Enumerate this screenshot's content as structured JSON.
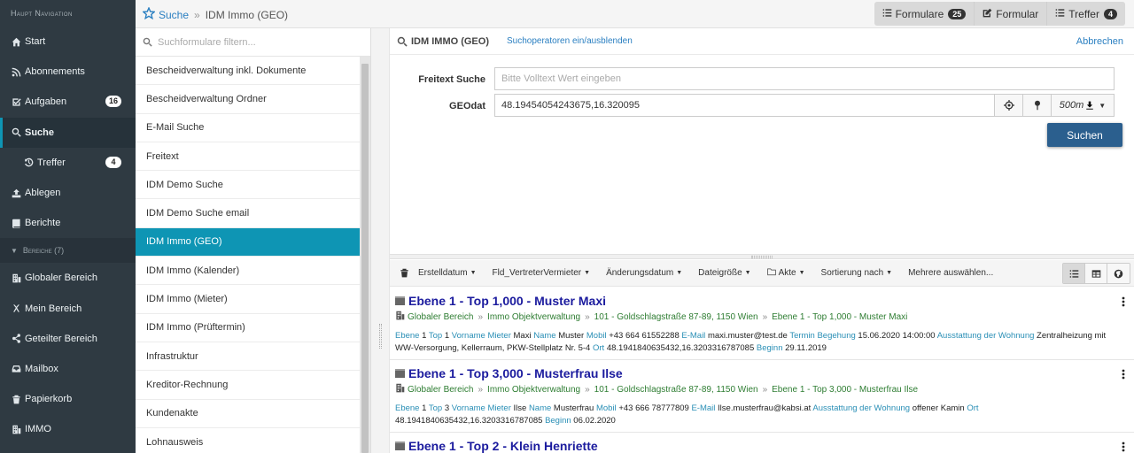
{
  "sidebar": {
    "heading": "Haupt Navigation",
    "items": [
      {
        "label": "Start",
        "icon": "home-icon"
      },
      {
        "label": "Abonnements",
        "icon": "rss-icon"
      },
      {
        "label": "Aufgaben",
        "icon": "check-square-icon",
        "badge": "16"
      },
      {
        "label": "Suche",
        "icon": "search-icon"
      },
      {
        "label": "Treffer",
        "icon": "history-icon",
        "badge": "4"
      },
      {
        "label": "Ablegen",
        "icon": "upload-icon"
      },
      {
        "label": "Berichte",
        "icon": "book-icon"
      }
    ],
    "group_label": "Bereiche (7)",
    "areas": [
      {
        "label": "Globaler Bereich",
        "icon": "building-icon"
      },
      {
        "label": "Mein Bereich",
        "icon": "user-icon"
      },
      {
        "label": "Geteilter Bereich",
        "icon": "share-icon"
      },
      {
        "label": "Mailbox",
        "icon": "inbox-icon"
      },
      {
        "label": "Papierkorb",
        "icon": "trash-icon"
      },
      {
        "label": "IMMO",
        "icon": "building-icon"
      }
    ]
  },
  "topbar": {
    "breadcrumb_root": "Suche",
    "breadcrumb_current": "IDM Immo (GEO)",
    "btn_formulare": "Formulare",
    "btn_formulare_count": "25",
    "btn_formular": "Formular",
    "btn_treffer": "Treffer",
    "btn_treffer_count": "4"
  },
  "forms": {
    "filter_placeholder": "Suchformulare filtern...",
    "items": [
      "Bescheidverwaltung inkl. Dokumente",
      "Bescheidverwaltung Ordner",
      "E-Mail Suche",
      "Freitext",
      "IDM Demo Suche",
      "IDM Demo Suche email",
      "IDM Immo (GEO)",
      "IDM Immo (Kalender)",
      "IDM Immo (Mieter)",
      "IDM Immo (Prüftermin)",
      "Infrastruktur",
      "Kreditor-Rechnung",
      "Kundenakte",
      "Lohnausweis"
    ]
  },
  "search": {
    "title": "IDM IMMO (GEO)",
    "toggle_operators": "Suchoperatoren ein/ausblenden",
    "cancel": "Abbrechen",
    "freitext_label": "Freitext Suche",
    "freitext_placeholder": "Bitte Volltext Wert eingeben",
    "geo_label": "GEOdat",
    "geo_value": "48.19454054243675,16.320095",
    "radius": "500m",
    "submit": "Suchen"
  },
  "toolbar": {
    "sort_fields": [
      "Erstelldatum",
      "Fld_VertreterVermieter",
      "Änderungsdatum",
      "Dateigröße",
      "Akte",
      "Sortierung nach"
    ],
    "more": "Mehrere auswählen..."
  },
  "results": [
    {
      "title": "Ebene 1 - Top 1,000 - Muster Maxi",
      "path": [
        "Globaler Bereich",
        "Immo Objektverwaltung",
        "101 - Goldschlagstraße 87-89, 1150 Wien",
        "Ebene 1 - Top 1,000 - Muster Maxi"
      ],
      "meta": [
        {
          "k": "Ebene",
          "v": "1"
        },
        {
          "k": "Top",
          "v": "1"
        },
        {
          "k": "Vorname Mieter",
          "v": "Maxi"
        },
        {
          "k": "Name",
          "v": "Muster"
        },
        {
          "k": "Mobil",
          "v": "+43 664 61552288"
        },
        {
          "k": "E-Mail",
          "v": "maxi.muster@test.de"
        },
        {
          "k": "Termin Begehung",
          "v": "15.06.2020 14:00:00"
        },
        {
          "k": "Ausstattung der Wohnung",
          "v": "Zentralheizung mit WW-Versorgung, Kellerraum, PKW-Stellplatz Nr. 5-4"
        },
        {
          "k": "Ort",
          "v": "48.1941840635432,16.3203316787085"
        },
        {
          "k": "Beginn",
          "v": "29.11.2019"
        }
      ]
    },
    {
      "title": "Ebene 1 - Top 3,000 - Musterfrau Ilse",
      "path": [
        "Globaler Bereich",
        "Immo Objektverwaltung",
        "101 - Goldschlagstraße 87-89, 1150 Wien",
        "Ebene 1 - Top 3,000 - Musterfrau Ilse"
      ],
      "meta": [
        {
          "k": "Ebene",
          "v": "1"
        },
        {
          "k": "Top",
          "v": "3"
        },
        {
          "k": "Vorname Mieter",
          "v": "Ilse"
        },
        {
          "k": "Name",
          "v": "Musterfrau"
        },
        {
          "k": "Mobil",
          "v": "+43 666 78777809"
        },
        {
          "k": "E-Mail",
          "v": "Ilse.musterfrau@kabsi.at"
        },
        {
          "k": "Ausstattung der Wohnung",
          "v": "offener Kamin"
        },
        {
          "k": "Ort",
          "v": "48.1941840635432,16.3203316787085"
        },
        {
          "k": "Beginn",
          "v": "06.02.2020"
        }
      ]
    },
    {
      "title": "Ebene 1 - Top 2 - Klein Henriette",
      "path": [],
      "meta": []
    }
  ],
  "colors": {
    "sidebar": "#2f3a42",
    "accent": "#0e95b4",
    "link": "#2a7fc1",
    "primary_button": "#2b5f8e",
    "result_title": "#1b1b9e",
    "path": "#2e7d32"
  }
}
